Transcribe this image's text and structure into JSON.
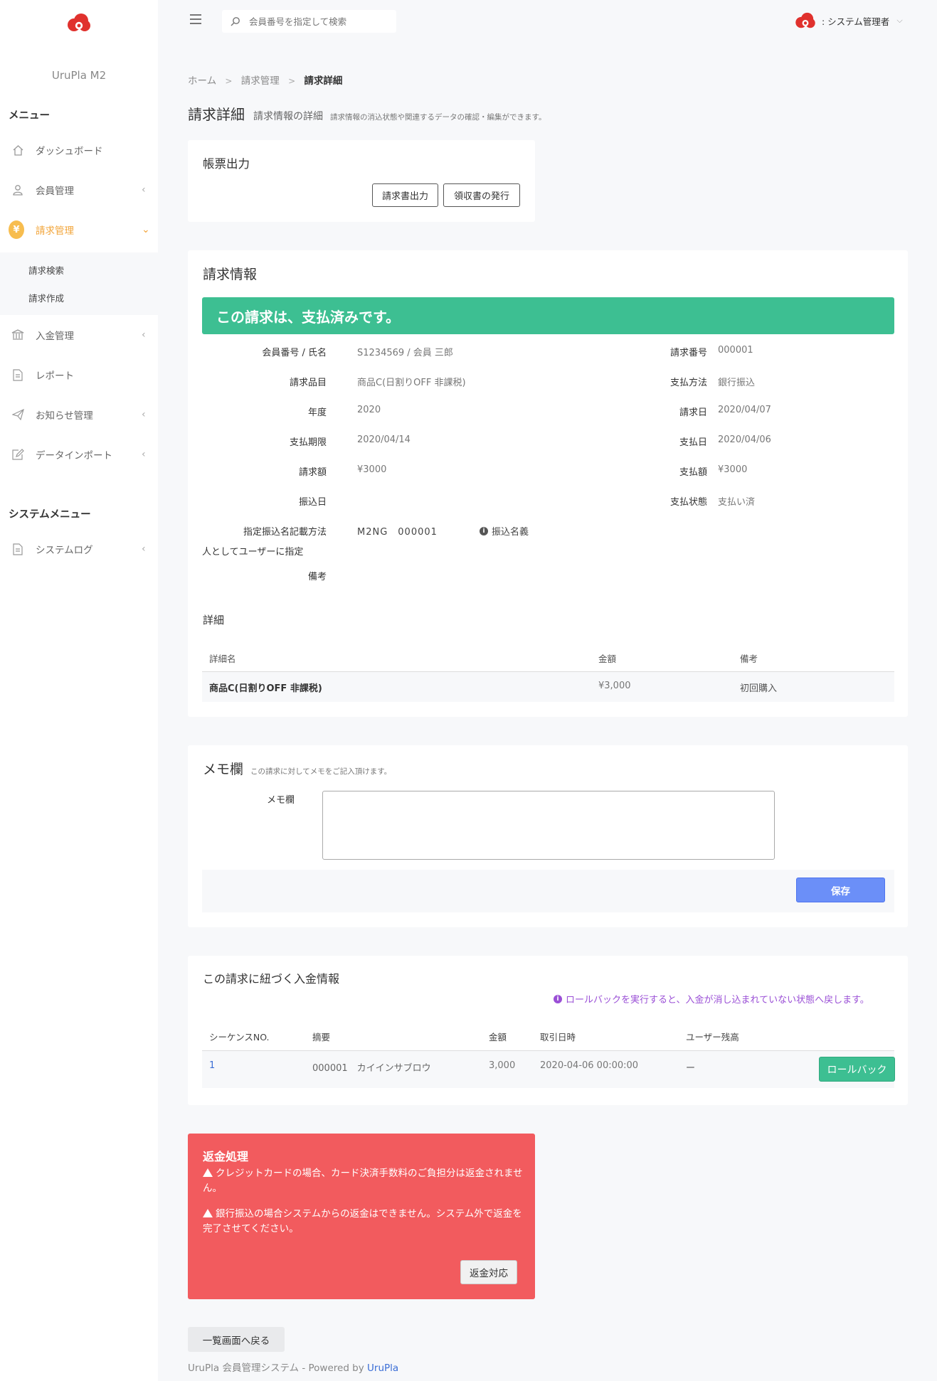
{
  "brand": {
    "name": "UruPla M2"
  },
  "sidebar": {
    "menu_title": "メニュー",
    "items": [
      {
        "label": "ダッシュボード",
        "icon": "home-icon"
      },
      {
        "label": "会員管理",
        "icon": "user-icon",
        "chev": "‹"
      },
      {
        "label": "請求管理",
        "icon": "yen-icon",
        "chev": "⌄",
        "badge": "¥"
      },
      {
        "label": "入金管理",
        "icon": "bank-icon",
        "chev": "‹"
      },
      {
        "label": "レポート",
        "icon": "document-icon"
      },
      {
        "label": "お知らせ管理",
        "icon": "send-icon",
        "chev": "‹"
      },
      {
        "label": "データインポート",
        "icon": "edit-icon",
        "chev": "‹"
      }
    ],
    "subitems": [
      {
        "label": "請求検索"
      },
      {
        "label": "請求作成"
      }
    ],
    "system_title": "システムメニュー",
    "system_items": [
      {
        "label": "システムログ",
        "icon": "document-icon",
        "chev": "‹"
      }
    ]
  },
  "topbar": {
    "search_placeholder": "会員番号を指定して検索",
    "user_name": ": システム管理者",
    "user_chev": "⌵"
  },
  "breadcrumb": {
    "home": "ホーム",
    "billing": "請求管理",
    "current": "請求詳細",
    "sep": ">"
  },
  "page": {
    "title": "請求詳細",
    "subtitle": "請求情報の詳細",
    "description": "請求情報の消込状態や関連するデータの確認・編集ができます。"
  },
  "forms_card": {
    "title": "帳票出力",
    "invoice_button": "請求書出力",
    "receipt_button": "領収書の発行"
  },
  "billing": {
    "title": "請求情報",
    "paid_banner": "この請求は、支払済みです。",
    "left": [
      {
        "label": "会員番号 / 氏名",
        "value": "S1234569 / 会員 三郎"
      },
      {
        "label": "請求品目",
        "value": "商品C(日割りOFF 非課税)"
      },
      {
        "label": "年度",
        "value": "2020"
      },
      {
        "label": "支払期限",
        "value": "2020/04/14"
      },
      {
        "label": "請求額",
        "value": "¥3000"
      },
      {
        "label": "振込日",
        "value": ""
      }
    ],
    "right": [
      {
        "label": "請求番号",
        "value": "000001"
      },
      {
        "label": "支払方法",
        "value": "銀行振込"
      },
      {
        "label": "請求日",
        "value": "2020/04/07"
      },
      {
        "label": "支払日",
        "value": "2020/04/06"
      },
      {
        "label": "支払額",
        "value": "¥3000"
      },
      {
        "label": "支払状態",
        "value": "支払い済"
      }
    ],
    "transfer_label_1": "指定振込名記載方法",
    "transfer_label_2": "人としてユーザーに指定",
    "transfer_value": "M2NG　000001",
    "transfer_note": "振込名義",
    "remarks_label": "備考",
    "details_title": "詳細",
    "details_headers": {
      "name": "詳細名",
      "amount": "金額",
      "remarks": "備考"
    },
    "details_rows": [
      {
        "name": "商品C(日割りOFF 非課税)",
        "amount": "¥3,000",
        "remarks": "初回購入"
      }
    ]
  },
  "memo": {
    "title": "メモ欄",
    "description": "この請求に対してメモをご記入頂けます。",
    "label": "メモ欄",
    "value": "",
    "save_button": "保存"
  },
  "payments": {
    "title": "この請求に紐づく入金情報",
    "note": "ロールバックを実行すると、入金が消し込まれていない状態へ戻します。",
    "headers": {
      "seq": "シーケンスNO.",
      "summary": "摘要",
      "amount": "金額",
      "datetime": "取引日時",
      "balance": "ユーザー残高"
    },
    "rows": [
      {
        "seq": "1",
        "summary": "000001　カイインサブロウ",
        "amount": "3,000",
        "datetime": "2020-04-06 00:00:00",
        "balance": "ー",
        "action": "ロールバック"
      }
    ]
  },
  "refund": {
    "title": "返金処理",
    "line1": "クレジットカードの場合、カード決済手数料のご負担分は返金されません。",
    "line2": "銀行振込の場合システムからの返金はできません。システム外で返金を完了させてください。",
    "button": "返金対応"
  },
  "back_button": "一覧画面へ戻る",
  "footer": {
    "text": "UruPla 会員管理システム - Powered by",
    "brand": "UruPla"
  },
  "colors": {
    "accent": "#f2a53a",
    "success": "#3dbf92",
    "primary": "#6b8ff8",
    "danger": "#f25b5e",
    "purple": "#9a4fd6",
    "link": "#3b6ed6"
  }
}
